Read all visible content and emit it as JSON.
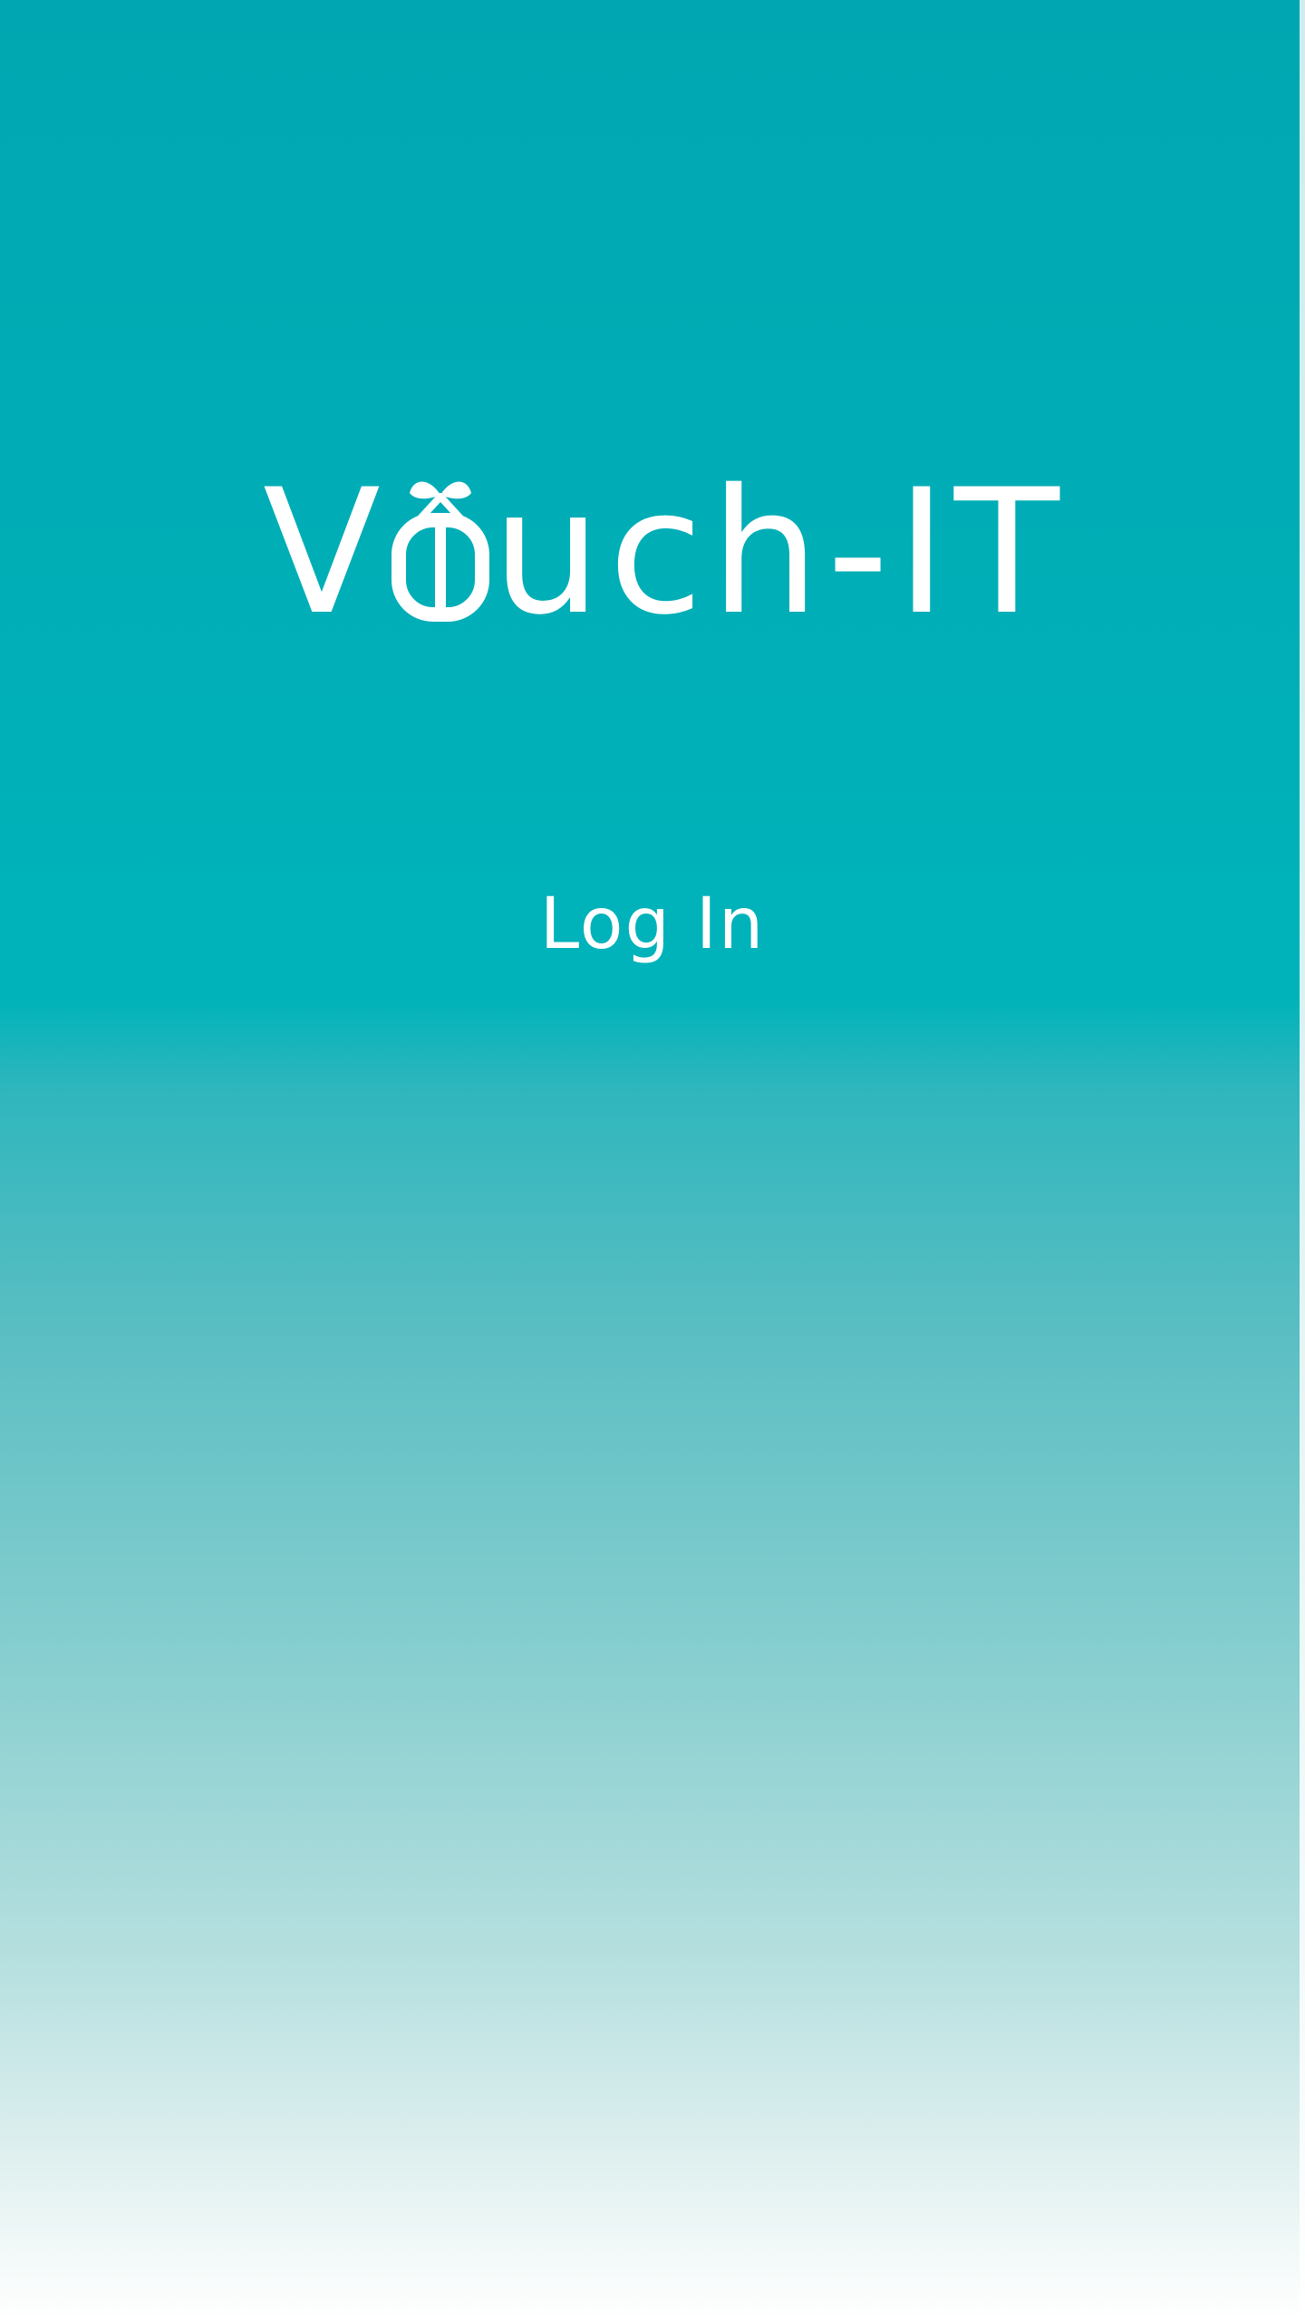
{
  "app": {
    "logo_text_before": "V",
    "logo_text_after": "uch-IT",
    "logo_icon": "gift-icon"
  },
  "actions": {
    "login_label": "Log In"
  },
  "colors": {
    "gradient_top": "#00a7b2",
    "gradient_mid": "#5cbfc3",
    "gradient_bottom": "#ffffff",
    "text": "#ffffff"
  }
}
